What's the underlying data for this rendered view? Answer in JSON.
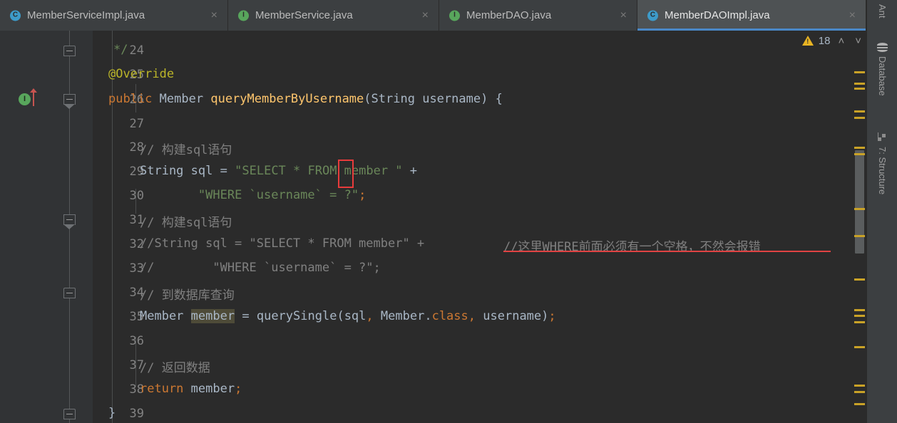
{
  "window": {
    "theme_bg": "#2b2b2b",
    "accent": "#4a88c7"
  },
  "tabs": [
    {
      "label": "MemberServiceImpl.java",
      "icon": "class-icon",
      "icon_letter": "C",
      "icon_color": "#3d9bc9",
      "active": false,
      "close": "×"
    },
    {
      "label": "MemberService.java",
      "icon": "interface-icon",
      "icon_letter": "I",
      "icon_color": "#58a65c",
      "active": false,
      "close": "×"
    },
    {
      "label": "MemberDAO.java",
      "icon": "interface-icon",
      "icon_letter": "I",
      "icon_color": "#58a65c",
      "active": false,
      "close": "×"
    },
    {
      "label": "MemberDAOImpl.java",
      "icon": "class-icon",
      "icon_letter": "C",
      "icon_color": "#3d9bc9",
      "active": true,
      "close": "×"
    }
  ],
  "inspection": {
    "warning_count": "18",
    "warning_color": "#e8b423",
    "prev_label": "˄",
    "next_label": "˅"
  },
  "editor": {
    "first_line": 24,
    "lines": [
      {
        "num": "24",
        "text": "    */"
      },
      {
        "num": "25",
        "text": "    @Override"
      },
      {
        "num": "26",
        "text": "    public Member queryMemberByUsername(String username) {"
      },
      {
        "num": "27",
        "text": ""
      },
      {
        "num": "28",
        "text": "        // 构建sql语句"
      },
      {
        "num": "29",
        "text": "        String sql = \"SELECT * FROM member \" +"
      },
      {
        "num": "30",
        "text": "                \"WHERE `username` = ?\";"
      },
      {
        "num": "31",
        "text": "        // 构建sql语句"
      },
      {
        "num": "32",
        "text": "        //String sql = \"SELECT * FROM member\" +"
      },
      {
        "num": "33",
        "text": "        //        \"WHERE `username` = ?\";"
      },
      {
        "num": "34",
        "text": "        // 到数据库查询"
      },
      {
        "num": "35",
        "text": "        Member member = querySingle(sql, Member.class, username);"
      },
      {
        "num": "36",
        "text": ""
      },
      {
        "num": "37",
        "text": "        // 返回数据"
      },
      {
        "num": "38",
        "text": "        return member;"
      },
      {
        "num": "39",
        "text": "    }"
      }
    ],
    "gutter_icon_line_26": {
      "name": "implements-method-icon",
      "letter": "I"
    },
    "highlighted_identifier": "member",
    "fold_marker_lines": [
      "24",
      "26",
      "31",
      "34",
      "39"
    ]
  },
  "annotation": {
    "text": "//这里WHERE前面必须有一个空格，不然会报错",
    "color": "#e04343",
    "box_target": "space before closing quote on line 29"
  },
  "right_tool_window": {
    "items": [
      {
        "label": "Ant",
        "icon": "ant-icon"
      },
      {
        "label": "Database",
        "icon": "database-icon"
      },
      {
        "label": "7: Structure",
        "icon": "structure-icon"
      }
    ]
  },
  "scrollbar": {
    "marker_color": "#c9a227",
    "thumb_color": "#5a5d5e"
  }
}
